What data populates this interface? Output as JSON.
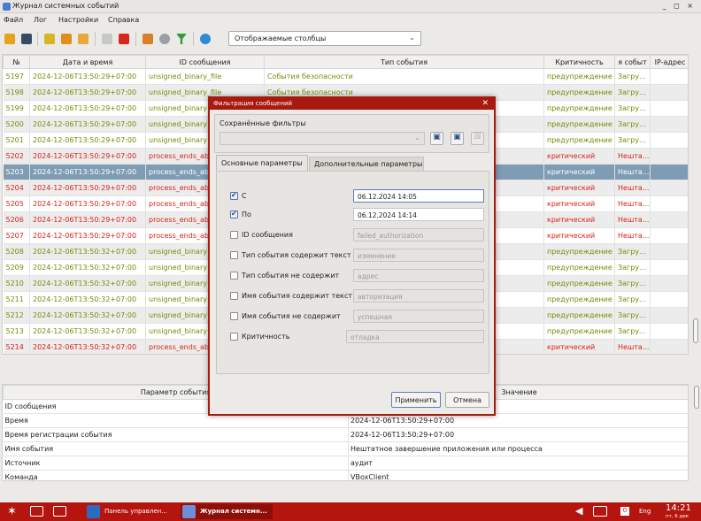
{
  "window": {
    "title": "Журнал системных событий",
    "controls": "_ ◻ ×"
  },
  "menu": [
    "Файл",
    "Лог",
    "Настройки",
    "Справка"
  ],
  "toolbar": {
    "columns_select": "Отображаемые столбцы"
  },
  "table": {
    "headers": [
      "№",
      "Дата и время",
      "ID сообщения",
      "Тип события",
      "Критичность",
      "я событ",
      "IP-адрес"
    ],
    "rows": [
      {
        "n": "5197",
        "dt": "2024-12-06T13:50:29+07:00",
        "id": "unsigned_binary_file",
        "type": "События безопасности",
        "crit": "предупреждение",
        "ev": "Загру...",
        "ip": "",
        "kind": "warn"
      },
      {
        "n": "5198",
        "dt": "2024-12-06T13:50:29+07:00",
        "id": "unsigned_binary_file",
        "type": "События безопасности",
        "crit": "предупреждение",
        "ev": "Загру...",
        "ip": "",
        "kind": "warn"
      },
      {
        "n": "5199",
        "dt": "2024-12-06T13:50:29+07:00",
        "id": "unsigned_binary",
        "type": "",
        "crit": "предупреждение",
        "ev": "Загру...",
        "ip": "",
        "kind": "warn"
      },
      {
        "n": "5200",
        "dt": "2024-12-06T13:50:29+07:00",
        "id": "unsigned_binary",
        "type": "",
        "crit": "предупреждение",
        "ev": "Загру...",
        "ip": "",
        "kind": "warn"
      },
      {
        "n": "5201",
        "dt": "2024-12-06T13:50:29+07:00",
        "id": "unsigned_binary",
        "type": "",
        "crit": "предупреждение",
        "ev": "Загру...",
        "ip": "",
        "kind": "warn"
      },
      {
        "n": "5202",
        "dt": "2024-12-06T13:50:29+07:00",
        "id": "process_ends_ab",
        "type": "",
        "crit": "критический",
        "ev": "Нешта...",
        "ip": "",
        "kind": "crit"
      },
      {
        "n": "5203",
        "dt": "2024-12-06T13:50:29+07:00",
        "id": "process_ends_ab",
        "type": "",
        "crit": "критический",
        "ev": "Нешта...",
        "ip": "",
        "kind": "sel"
      },
      {
        "n": "5204",
        "dt": "2024-12-06T13:50:29+07:00",
        "id": "process_ends_ab",
        "type": "",
        "crit": "критический",
        "ev": "Нешта...",
        "ip": "",
        "kind": "crit"
      },
      {
        "n": "5205",
        "dt": "2024-12-06T13:50:29+07:00",
        "id": "process_ends_ab",
        "type": "",
        "crit": "критический",
        "ev": "Нешта...",
        "ip": "",
        "kind": "crit"
      },
      {
        "n": "5206",
        "dt": "2024-12-06T13:50:29+07:00",
        "id": "process_ends_ab",
        "type": "",
        "crit": "критический",
        "ev": "Нешта...",
        "ip": "",
        "kind": "crit"
      },
      {
        "n": "5207",
        "dt": "2024-12-06T13:50:29+07:00",
        "id": "process_ends_ab",
        "type": "",
        "crit": "критический",
        "ev": "Нешта...",
        "ip": "",
        "kind": "crit"
      },
      {
        "n": "5208",
        "dt": "2024-12-06T13:50:32+07:00",
        "id": "unsigned_binary",
        "type": "",
        "crit": "предупреждение",
        "ev": "Загру...",
        "ip": "",
        "kind": "warn"
      },
      {
        "n": "5209",
        "dt": "2024-12-06T13:50:32+07:00",
        "id": "unsigned_binary",
        "type": "",
        "crit": "предупреждение",
        "ev": "Загру...",
        "ip": "",
        "kind": "warn"
      },
      {
        "n": "5210",
        "dt": "2024-12-06T13:50:32+07:00",
        "id": "unsigned_binary",
        "type": "",
        "crit": "предупреждение",
        "ev": "Загру...",
        "ip": "",
        "kind": "warn"
      },
      {
        "n": "5211",
        "dt": "2024-12-06T13:50:32+07:00",
        "id": "unsigned_binary",
        "type": "",
        "crit": "предупреждение",
        "ev": "Загру...",
        "ip": "",
        "kind": "warn"
      },
      {
        "n": "5212",
        "dt": "2024-12-06T13:50:32+07:00",
        "id": "unsigned_binary",
        "type": "",
        "crit": "предупреждение",
        "ev": "Загру...",
        "ip": "",
        "kind": "warn"
      },
      {
        "n": "5213",
        "dt": "2024-12-06T13:50:32+07:00",
        "id": "unsigned_binary",
        "type": "",
        "crit": "предупреждение",
        "ev": "Загру...",
        "ip": "",
        "kind": "warn"
      },
      {
        "n": "5214",
        "dt": "2024-12-06T13:50:32+07:00",
        "id": "process_ends_ab",
        "type": "",
        "crit": "критический",
        "ev": "Нешта...",
        "ip": "",
        "kind": "crit"
      }
    ]
  },
  "details": {
    "headers": [
      "Параметр события",
      "Значение"
    ],
    "rows": [
      {
        "k": "ID сообщения",
        "v": ""
      },
      {
        "k": "Время",
        "v": "2024-12-06T13:50:29+07:00"
      },
      {
        "k": "Время регистрации события",
        "v": "2024-12-06T13:50:29+07:00"
      },
      {
        "k": "Имя события",
        "v": "Нештатное завершение приложения или процесса"
      },
      {
        "k": "Источник",
        "v": "аудит"
      },
      {
        "k": "Команда",
        "v": "VBoxClient"
      }
    ]
  },
  "dialog": {
    "title": "Фильтрация сообщений",
    "saved_filters_label": "Сохранённые фильтры",
    "tabs": [
      "Основные параметры",
      "Дополнительные параметры"
    ],
    "from_label": "С",
    "from_value": "06.12.2024 14:05",
    "to_label": "По",
    "to_value": "06.12.2024 14:14",
    "fields": [
      {
        "label": "ID сообщения",
        "placeholder": "failed_authorization"
      },
      {
        "label": "Тип события содержит текст",
        "placeholder": "изменение"
      },
      {
        "label": "Тип события не содержит",
        "placeholder": "адрес"
      },
      {
        "label": "Имя события содержит текст",
        "placeholder": "авторизация"
      },
      {
        "label": "Имя события не содержит",
        "placeholder": "успешная"
      }
    ],
    "criticality_label": "Критичность",
    "criticality_value": "отладка",
    "apply": "Применить",
    "cancel": "Отмена"
  },
  "taskbar": {
    "item1": "Панель управлен...",
    "item2": "Журнал системн...",
    "lang": "Eng",
    "badge": "0",
    "time": "14:21",
    "date": "пт, 6 дек"
  },
  "colors": {
    "warn": "#7a8a06",
    "crit": "#d8231a",
    "selected": "#7f9cb5",
    "taskbar": "#b5150f",
    "dialog_border": "#a8190f"
  }
}
